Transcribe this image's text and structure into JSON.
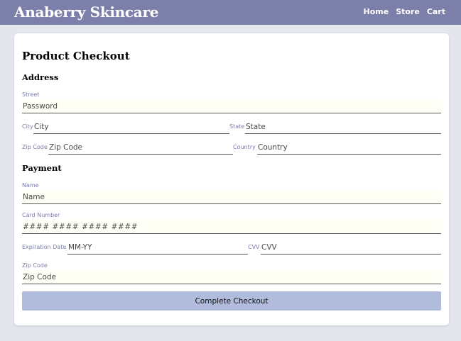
{
  "header": {
    "brand": "Anaberry Skincare",
    "nav": [
      "Home",
      "Store",
      "Cart"
    ]
  },
  "checkout": {
    "title": "Product Checkout",
    "address_heading": "Address",
    "street_label": "Street",
    "street_placeholder": "Password",
    "city_label": "City",
    "city_placeholder": "City",
    "state_label": "State",
    "state_placeholder": "State",
    "zip_label": "Zip Code",
    "zip_placeholder": "Zip Code",
    "country_label": "Country",
    "country_placeholder": "Country",
    "payment_heading": "Payment",
    "name_label": "Name",
    "name_placeholder": "Name",
    "card_label": "Card Number",
    "card_placeholder": "#### #### #### ####",
    "exp_label": "Expiration Date",
    "exp_placeholder": "MM-YY",
    "cvv_label": "CVV",
    "cvv_placeholder": "CVV",
    "pay_zip_label": "Zip Code",
    "pay_zip_placeholder": "Zip Code",
    "submit_label": "Complete Checkout"
  },
  "colors": {
    "header_bg": "#7d7fab",
    "page_bg": "#e4e6ed",
    "label": "#7a7caf",
    "button_bg": "#b1bbdb"
  }
}
